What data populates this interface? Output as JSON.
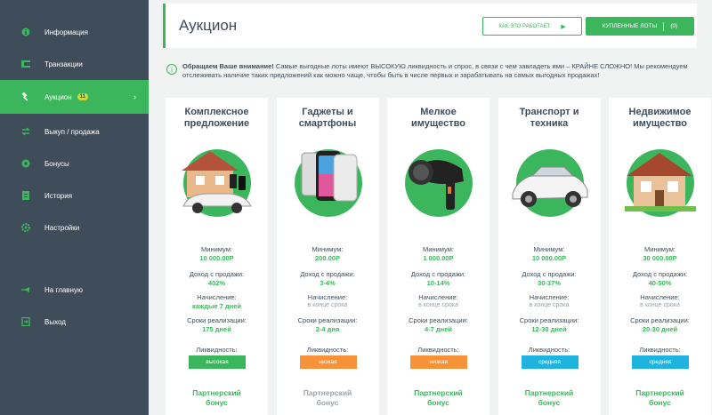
{
  "sidebar": {
    "items": [
      {
        "label": "Информация",
        "icon": "info-icon"
      },
      {
        "label": "Транзакции",
        "icon": "transactions-icon"
      },
      {
        "label": "Аукцион",
        "icon": "hammer-icon",
        "badge": "11",
        "active": true
      },
      {
        "label": "Выкуп / продажа",
        "icon": "exchange-icon"
      },
      {
        "label": "Бонусы",
        "icon": "bonus-icon"
      },
      {
        "label": "История",
        "icon": "history-icon"
      },
      {
        "label": "Настройки",
        "icon": "settings-icon"
      },
      {
        "label": "На главную",
        "icon": "home-icon"
      },
      {
        "label": "Выход",
        "icon": "logout-icon"
      }
    ]
  },
  "header": {
    "title": "Аукцион",
    "how_label": "КАК ЭТО РАБОТАЕТ",
    "lots_label": "КУПЛЕННЫЕ ЛОТЫ",
    "lots_count": "(0)"
  },
  "notice": {
    "bold": "Обращаем Ваше внимание!",
    "text": " Самые выгодные лоты имеют ВЫСОКУЮ ликвидность и спрос, в связи с чем завладеть ими – КРАЙНЕ СЛОЖНО! Мы рекомендуем отслеживать наличие таких предложений как можно чаще, чтобы быть в числе первых и зарабатывать на самых выгодных продажах!"
  },
  "labels": {
    "min": "Минимум:",
    "income": "Доход с продажи:",
    "accrual": "Начисление:",
    "terms": "Сроки реализации:",
    "liquidity": "Ликвидность:",
    "partner_line1": "Партнерский",
    "partner_line2": "бонус"
  },
  "colors": {
    "accent": "#3cb65c",
    "sidebar": "#3f4d5b",
    "high": "#3cb65c",
    "low": "#f5923a",
    "mid": "#1fb3e0"
  },
  "cards": [
    {
      "title1": "Комплексное",
      "title2": "предложение",
      "image": "house-car-icon",
      "min": "10 000.00Р",
      "income": "402%",
      "accrual": "каждые 7 дней",
      "terms": "175 дней",
      "liquidity": "высокая",
      "liq_color": "#3cb65c",
      "partner_active": true
    },
    {
      "title1": "Гаджеты и",
      "title2": "смартфоны",
      "image": "smartphones-icon",
      "min": "200.00Р",
      "income": "3-4%",
      "accrual": "в конце срока",
      "terms": "2-4 дня",
      "liquidity": "низкая",
      "liq_color": "#f5923a",
      "partner_active": false
    },
    {
      "title1": "Мелкое",
      "title2": "имущество",
      "image": "hairdryer-icon",
      "min": "1 000.00Р",
      "income": "10-14%",
      "accrual": "в конце срока",
      "terms": "4-7 дней",
      "liquidity": "низкая",
      "liq_color": "#f5923a",
      "partner_active": true
    },
    {
      "title1": "Транспорт и",
      "title2": "техника",
      "image": "car-icon",
      "min": "10 000.00Р",
      "income": "30-37%",
      "accrual": "в конце срока",
      "terms": "12-30 дней",
      "liquidity": "средняя",
      "liq_color": "#1fb3e0",
      "partner_active": true
    },
    {
      "title1": "Недвижимое",
      "title2": "имущество",
      "image": "house-icon",
      "min": "30 000.00Р",
      "income": "40-50%",
      "accrual": "в конце срока",
      "terms": "20-30 дней",
      "liquidity": "средняя",
      "liq_color": "#1fb3e0",
      "partner_active": true
    }
  ]
}
